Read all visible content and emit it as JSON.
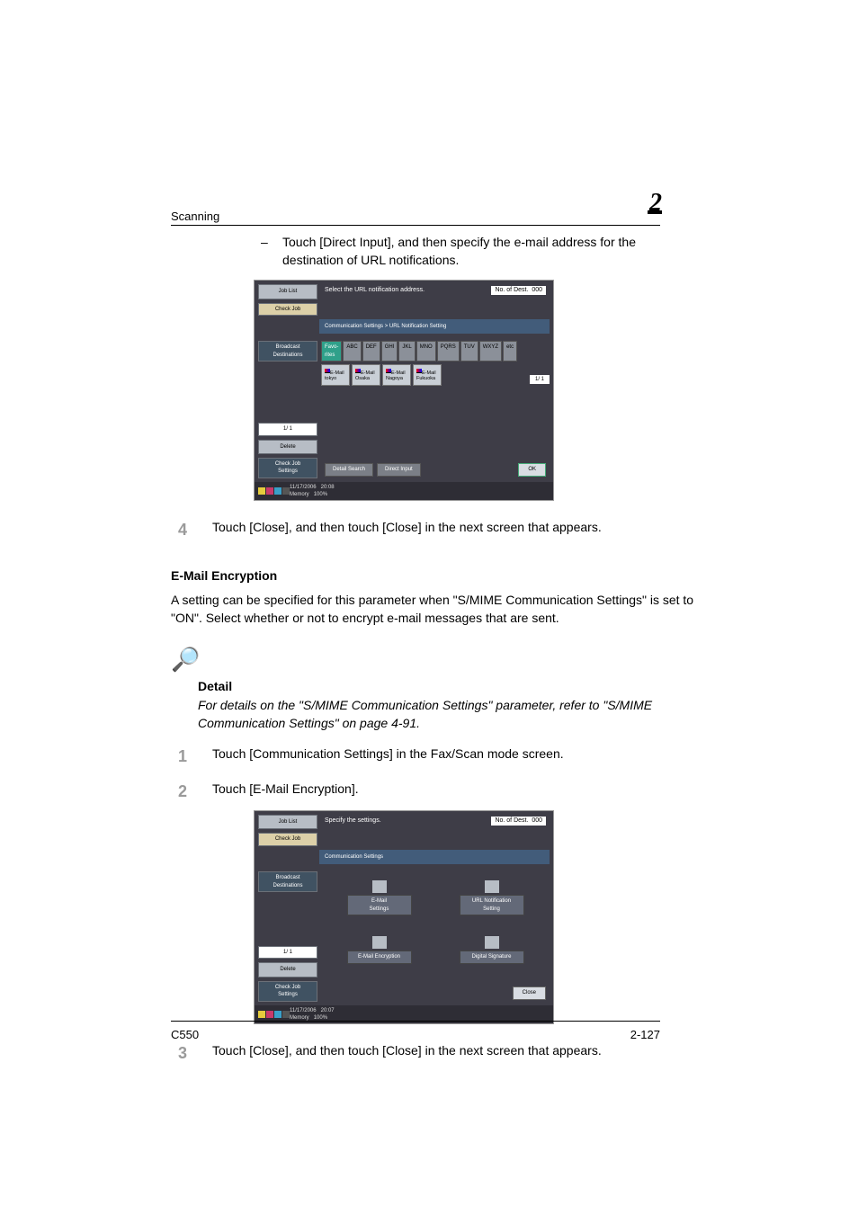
{
  "header": {
    "title": "Scanning",
    "chapter": "2"
  },
  "bullet": "Touch [Direct Input], and then specify the e-mail address for the destination of URL notifications.",
  "ss1": {
    "jobList": "Job List",
    "checkJob": "Check Job",
    "broadcast": "Broadcast\nDestinations",
    "pager": "1/  1",
    "delete": "Delete",
    "checkJobSettings": "Check Job\nSettings",
    "instruction": "Select the URL notification address.",
    "nos": "No. of\nDest.",
    "nosVal": "000",
    "breadcrumb": "Communication Settings > URL Notification Setting",
    "tabs": [
      "Favo-\nrites",
      "ABC",
      "DEF",
      "GHI",
      "JKL",
      "MNO",
      "PQRS",
      "TUV",
      "WXYZ",
      "etc"
    ],
    "chips": [
      "E-Mail tokyo",
      "E-Mail Osaka",
      "E-Mail Nagoya",
      "E-Mail Fukuoka"
    ],
    "chipPager": "1/  1",
    "detailSearch": "Detail Search",
    "directInput": "Direct Input",
    "ok": "OK",
    "status": {
      "date": "11/17/2006",
      "time": "20:08",
      "mem": "Memory",
      "memVal": "100%"
    }
  },
  "step4": {
    "n": "4",
    "t": "Touch [Close], and then touch [Close] in the next screen that appears."
  },
  "section": {
    "title": "E-Mail Encryption",
    "para": "A setting can be specified for this parameter when \"S/MIME Communication Settings\" is set to \"ON\". Select whether or not to encrypt e-mail messages that are sent."
  },
  "detail": {
    "title": "Detail",
    "text": "For details on the \"S/MIME Communication Settings\" parameter, refer to \"S/MIME Communication Settings\" on page 4-91."
  },
  "step1": {
    "n": "1",
    "t": "Touch [Communication Settings] in the Fax/Scan mode screen."
  },
  "step2": {
    "n": "2",
    "t": "Touch [E-Mail Encryption]."
  },
  "ss2": {
    "instruction": "Specify the settings.",
    "breadcrumb": "Communication Settings",
    "items": [
      "E-Mail\nSettings",
      "URL Notification\nSetting",
      "E-Mail Encryption",
      "Digital Signature"
    ],
    "close": "Close",
    "status": {
      "date": "11/17/2006",
      "time": "20:07",
      "mem": "Memory",
      "memVal": "100%"
    }
  },
  "step3": {
    "n": "3",
    "t": "Touch [Close], and then touch [Close] in the next screen that appears."
  },
  "footer": {
    "model": "C550",
    "page": "2-127"
  }
}
